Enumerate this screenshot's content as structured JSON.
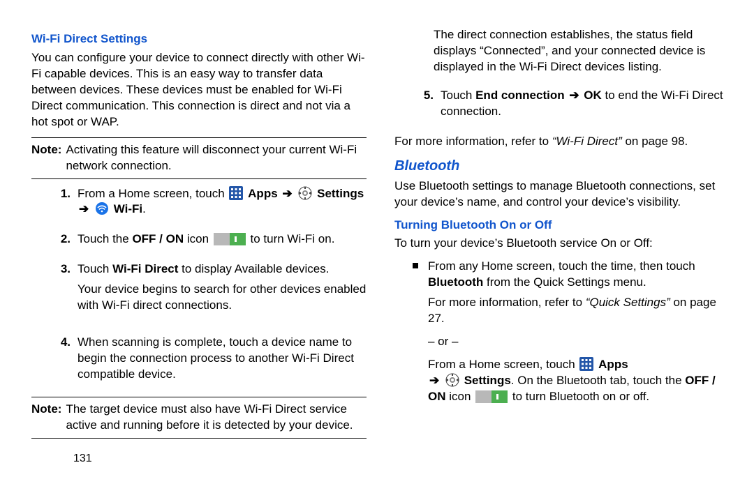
{
  "left": {
    "heading_wifi_direct": "Wi-Fi Direct Settings",
    "intro": "You can configure your device to connect directly with other Wi-Fi capable devices. This is an easy way to transfer data between devices. These devices must be enabled for Wi-Fi Direct communication. This connection is direct and not via a hot spot or WAP.",
    "note1_label": "Note:",
    "note1_text": "Activating this feature will disconnect your current Wi-Fi network connection.",
    "step1_a": "From a Home screen, touch ",
    "step1_apps": " Apps ",
    "step1_settings": " Settings",
    "step1_arrow2": " ",
    "step1_wifi_label": " Wi-Fi",
    "step1_period": ".",
    "step2_a": "Touch the ",
    "step2_b": "OFF / ON",
    "step2_c": " icon ",
    "step2_d": " to turn Wi-Fi on.",
    "step3_a": "Touch ",
    "step3_b": "Wi-Fi Direct",
    "step3_c": " to display Available devices.",
    "step3_p2": "Your device begins to search for other devices enabled with Wi-Fi direct connections.",
    "step4": "When scanning is complete, touch a device name to begin the connection process to another Wi-Fi Direct compatible device.",
    "note2_label": "Note:",
    "note2_text": "The target device must also have Wi-Fi Direct service active and running before it is detected by your device.",
    "page_num": "131"
  },
  "right": {
    "cont": "The direct connection establishes, the status field displays “Connected”, and your connected device is displayed in the Wi-Fi Direct devices listing.",
    "step5_a": "Touch ",
    "step5_b": "End connection ",
    "step5_c": " OK",
    "step5_d": " to end the Wi-Fi Direct connection.",
    "refer1_a": "For more information, refer to ",
    "refer1_b": "“Wi-Fi Direct”",
    "refer1_c": " on page 98.",
    "heading_bt": "Bluetooth",
    "bt_intro": "Use Bluetooth settings to manage Bluetooth connections, set your device’s name, and control your device’s visibility.",
    "heading_bt_onoff": "Turning Bluetooth On or Off",
    "bt_onoff_intro": "To turn your device’s Bluetooth service On or Off:",
    "bt_b1_a": "From any Home screen, touch the time, then touch ",
    "bt_b1_b": "Bluetooth",
    "bt_b1_c": " from the Quick Settings menu.",
    "bt_b1_p2a": "For more information, refer to ",
    "bt_b1_p2b": "“Quick Settings”",
    "bt_b1_p2c": " on page 27.",
    "or": "– or –",
    "bt_b2_a": "From a Home screen, touch ",
    "bt_b2_apps": " Apps",
    "bt_b2_arrow": " ",
    "bt_b2_settings": " Settings",
    "bt_b2_c": ". On the Bluetooth tab, touch the ",
    "bt_b2_d": "OFF / ON",
    "bt_b2_e": " icon ",
    "bt_b2_f": " to turn Bluetooth on or off."
  }
}
